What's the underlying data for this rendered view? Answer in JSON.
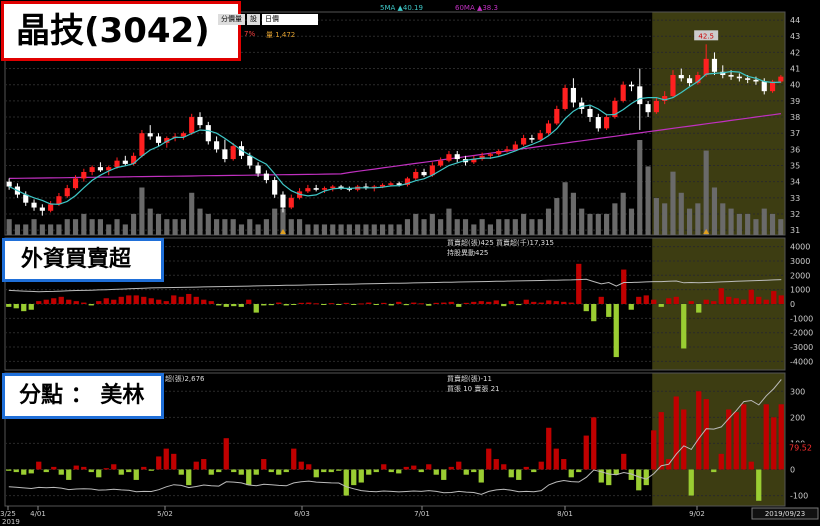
{
  "title": "晶技(3042)",
  "subchart1_label": "外資買賣超",
  "subchart2_label": "分點 ： 美林",
  "toolbar": {
    "btn1": "分價量",
    "btn2": "設",
    "period": "日價"
  },
  "main_info": {
    "change_pct": "7%",
    "volume_label": "量 1,472"
  },
  "legend": {
    "sma": "5MA ▲40.19",
    "ma60": "60MA ▲38.3"
  },
  "price_max_label": "42.5",
  "sub1_info": {
    "line1": "買賣超(張)425 買賣超(千)17,315",
    "line2": "持股異動425"
  },
  "sub2_info": {
    "left": "超(張)2,676",
    "line1": "買賣超(張)-11",
    "line2": "買張 10 賣張 21"
  },
  "sub2_last_value": "79.52",
  "bottom_dates": [
    "3/25",
    "4/01",
    "5/02",
    "6/03",
    "7/01",
    "8/01",
    "9/02",
    "2019/09/23"
  ],
  "year_label": "2019",
  "colors": {
    "up": "#ff2020",
    "down": "#ffffff",
    "ma5": "#3ec7c7",
    "ma60": "#c030c0",
    "sell": "#9acd32",
    "buy": "#c00000",
    "highlight": "#3d3d12"
  },
  "chart_data": [
    {
      "type": "candlestick",
      "y_ticks": [
        31,
        32,
        33,
        34,
        35,
        36,
        37,
        38,
        39,
        40,
        41,
        42,
        43,
        44
      ],
      "ylim": [
        30.7,
        44.5
      ],
      "ohlc": [
        [
          34.0,
          34.2,
          33.5,
          33.7
        ],
        [
          33.7,
          33.9,
          33.0,
          33.2
        ],
        [
          33.2,
          33.4,
          32.5,
          32.7
        ],
        [
          32.7,
          32.9,
          32.2,
          32.4
        ],
        [
          32.4,
          32.6,
          31.9,
          32.2
        ],
        [
          32.2,
          32.8,
          32.1,
          32.6
        ],
        [
          32.6,
          33.3,
          32.5,
          33.1
        ],
        [
          33.1,
          33.8,
          33.0,
          33.6
        ],
        [
          33.6,
          34.4,
          33.5,
          34.2
        ],
        [
          34.2,
          34.8,
          34.0,
          34.6
        ],
        [
          34.6,
          35.0,
          34.4,
          34.9
        ],
        [
          34.9,
          35.2,
          34.6,
          34.7
        ],
        [
          34.7,
          35.0,
          34.4,
          34.9
        ],
        [
          34.9,
          35.5,
          34.8,
          35.3
        ],
        [
          35.3,
          35.6,
          35.0,
          35.1
        ],
        [
          35.1,
          35.8,
          35.0,
          35.6
        ],
        [
          35.6,
          37.2,
          35.5,
          37.0
        ],
        [
          37.0,
          37.5,
          36.6,
          36.8
        ],
        [
          36.8,
          37.0,
          36.2,
          36.4
        ],
        [
          36.4,
          36.8,
          36.1,
          36.7
        ],
        [
          36.7,
          37.0,
          36.5,
          36.8
        ],
        [
          36.8,
          37.1,
          36.6,
          37.0
        ],
        [
          37.0,
          38.2,
          36.9,
          38.0
        ],
        [
          38.0,
          38.3,
          37.3,
          37.5
        ],
        [
          37.5,
          37.7,
          36.3,
          36.5
        ],
        [
          36.5,
          36.8,
          35.8,
          36.0
        ],
        [
          36.0,
          36.6,
          35.2,
          35.4
        ],
        [
          35.4,
          36.4,
          35.3,
          36.2
        ],
        [
          36.2,
          36.5,
          35.4,
          35.6
        ],
        [
          35.6,
          35.8,
          34.8,
          35.0
        ],
        [
          35.0,
          35.2,
          34.3,
          34.5
        ],
        [
          34.5,
          34.7,
          33.9,
          34.1
        ],
        [
          34.1,
          34.3,
          33.0,
          33.2
        ],
        [
          33.2,
          33.4,
          32.1,
          32.4
        ],
        [
          32.4,
          33.2,
          32.3,
          33.0
        ],
        [
          33.0,
          33.6,
          32.9,
          33.4
        ],
        [
          33.4,
          33.8,
          33.3,
          33.6
        ],
        [
          33.6,
          33.8,
          33.4,
          33.5
        ],
        [
          33.5,
          33.7,
          33.3,
          33.6
        ],
        [
          33.6,
          33.8,
          33.4,
          33.7
        ],
        [
          33.7,
          33.8,
          33.5,
          33.6
        ],
        [
          33.6,
          33.7,
          33.4,
          33.5
        ],
        [
          33.5,
          33.8,
          33.4,
          33.7
        ],
        [
          33.7,
          33.9,
          33.5,
          33.6
        ],
        [
          33.6,
          33.8,
          33.4,
          33.7
        ],
        [
          33.7,
          33.9,
          33.6,
          33.8
        ],
        [
          33.8,
          34.0,
          33.7,
          33.9
        ],
        [
          33.9,
          34.0,
          33.7,
          33.8
        ],
        [
          33.8,
          34.3,
          33.7,
          34.2
        ],
        [
          34.2,
          34.8,
          34.1,
          34.6
        ],
        [
          34.6,
          34.8,
          34.3,
          34.4
        ],
        [
          34.4,
          35.2,
          34.3,
          35.0
        ],
        [
          35.0,
          35.5,
          34.9,
          35.3
        ],
        [
          35.3,
          35.9,
          35.2,
          35.7
        ],
        [
          35.7,
          35.9,
          35.2,
          35.4
        ],
        [
          35.4,
          35.6,
          35.0,
          35.2
        ],
        [
          35.2,
          35.6,
          35.1,
          35.4
        ],
        [
          35.4,
          35.8,
          35.3,
          35.6
        ],
        [
          35.6,
          35.8,
          35.4,
          35.7
        ],
        [
          35.7,
          36.0,
          35.6,
          35.9
        ],
        [
          35.9,
          36.2,
          35.8,
          36.0
        ],
        [
          36.0,
          36.5,
          35.9,
          36.3
        ],
        [
          36.3,
          36.9,
          36.2,
          36.7
        ],
        [
          36.7,
          36.9,
          36.4,
          36.6
        ],
        [
          36.6,
          37.2,
          36.5,
          37.0
        ],
        [
          37.0,
          37.8,
          36.9,
          37.6
        ],
        [
          37.6,
          38.7,
          37.5,
          38.5
        ],
        [
          38.5,
          40.0,
          38.4,
          39.8
        ],
        [
          39.8,
          40.4,
          38.6,
          38.9
        ],
        [
          38.9,
          39.2,
          38.2,
          38.5
        ],
        [
          38.5,
          38.7,
          37.7,
          38.0
        ],
        [
          38.0,
          38.2,
          37.1,
          37.3
        ],
        [
          37.3,
          38.2,
          37.2,
          38.0
        ],
        [
          38.0,
          39.2,
          37.9,
          39.0
        ],
        [
          39.0,
          40.2,
          38.9,
          40.0
        ],
        [
          40.0,
          40.2,
          39.6,
          39.9
        ],
        [
          39.9,
          41.0,
          37.2,
          38.8
        ],
        [
          38.8,
          39.0,
          38.0,
          38.3
        ],
        [
          38.3,
          39.2,
          38.2,
          39.0
        ],
        [
          39.0,
          39.6,
          38.8,
          39.3
        ],
        [
          39.3,
          40.9,
          39.2,
          40.6
        ],
        [
          40.6,
          41.0,
          40.2,
          40.4
        ],
        [
          40.4,
          40.6,
          39.9,
          40.1
        ],
        [
          40.1,
          40.8,
          40.0,
          40.6
        ],
        [
          40.6,
          42.5,
          40.5,
          41.6
        ],
        [
          41.6,
          42.0,
          40.6,
          40.8
        ],
        [
          40.8,
          41.2,
          40.4,
          40.6
        ],
        [
          40.6,
          40.9,
          40.3,
          40.5
        ],
        [
          40.5,
          40.7,
          40.2,
          40.4
        ],
        [
          40.4,
          40.6,
          40.1,
          40.3
        ],
        [
          40.3,
          40.5,
          40.0,
          40.2
        ],
        [
          40.2,
          40.4,
          39.4,
          39.6
        ],
        [
          39.6,
          40.3,
          39.5,
          40.2
        ],
        [
          40.2,
          40.6,
          40.1,
          40.5
        ]
      ],
      "volume": [
        3,
        2,
        2,
        3,
        2,
        2,
        2,
        3,
        3,
        4,
        3,
        3,
        2,
        3,
        2,
        4,
        9,
        5,
        4,
        3,
        3,
        3,
        8,
        5,
        4,
        3,
        3,
        3,
        2,
        3,
        2,
        3,
        5,
        5,
        3,
        3,
        2,
        2,
        2,
        2,
        2,
        2,
        2,
        2,
        2,
        2,
        2,
        2,
        3,
        4,
        3,
        4,
        3,
        5,
        3,
        3,
        2,
        3,
        2,
        3,
        3,
        3,
        4,
        3,
        3,
        5,
        7,
        10,
        8,
        5,
        4,
        4,
        4,
        6,
        8,
        5,
        18,
        13,
        7,
        6,
        12,
        8,
        5,
        6,
        16,
        9,
        6,
        5,
        4,
        4,
        3,
        5,
        4,
        3
      ]
    },
    {
      "type": "bar",
      "name": "外資買賣超",
      "y_ticks": [
        4000,
        3000,
        2000,
        1000,
        0,
        -1000,
        -2000,
        -3000,
        -4000
      ],
      "ylim": [
        -4600,
        4600
      ],
      "values": [
        -200,
        -300,
        -500,
        -400,
        200,
        300,
        400,
        500,
        300,
        200,
        100,
        -100,
        200,
        400,
        300,
        500,
        600,
        600,
        500,
        400,
        300,
        200,
        600,
        500,
        700,
        500,
        300,
        200,
        -100,
        -200,
        -150,
        -200,
        300,
        -600,
        -100,
        -80,
        100,
        -100,
        -50,
        80,
        100,
        50,
        -60,
        60,
        -40,
        80,
        -70,
        40,
        100,
        -60,
        80,
        -100,
        150,
        -80,
        100,
        50,
        -120,
        80,
        100,
        150,
        -200,
        80,
        150,
        200,
        150,
        250,
        -150,
        200,
        -80,
        300,
        150,
        100,
        250,
        200,
        150,
        100,
        2800,
        -500,
        -1200,
        500,
        -900,
        -3700,
        2400,
        -400,
        500,
        600,
        300,
        -200,
        400,
        500,
        -3100,
        200,
        -600,
        300,
        200,
        1100,
        500,
        400,
        300,
        1000,
        500,
        300,
        900,
        600
      ],
      "line": [
        950,
        920,
        900,
        880,
        860,
        870,
        880,
        900,
        920,
        940,
        950,
        960,
        980,
        1000,
        1020,
        1040,
        1060,
        1080,
        1100,
        1120,
        1130,
        1140,
        1150,
        1160,
        1170,
        1180,
        1190,
        1200,
        1210,
        1220,
        1230,
        1240,
        1250,
        1260,
        1270,
        1280,
        1290,
        1300,
        1310,
        1320,
        1330,
        1340,
        1350,
        1360,
        1370,
        1380,
        1390,
        1400,
        1410,
        1420,
        1430,
        1440,
        1450,
        1460,
        1470,
        1480,
        1490,
        1500,
        1510,
        1520,
        1530,
        1540,
        1550,
        1560,
        1570,
        1580,
        1590,
        1600,
        1610,
        1620,
        1630,
        1640,
        1650,
        1660,
        1670,
        1680,
        1700,
        1720,
        1560,
        1400,
        1500,
        1250,
        1500,
        1500,
        1520,
        1540,
        1560,
        1560,
        1580,
        1600,
        1480,
        1500,
        1480,
        1500,
        1520,
        1540,
        1560,
        1580,
        1600,
        1620,
        1640,
        1660,
        1680,
        1700
      ]
    },
    {
      "type": "bar",
      "name": "分點 美林",
      "y_ticks": [
        300,
        200,
        100,
        0,
        -100
      ],
      "ylim": [
        -140,
        370
      ],
      "values": [
        -5,
        -10,
        -20,
        -15,
        30,
        -10,
        10,
        -20,
        -40,
        15,
        10,
        -10,
        -30,
        5,
        20,
        -20,
        -10,
        -40,
        10,
        -5,
        50,
        80,
        60,
        -20,
        -60,
        30,
        40,
        -20,
        -10,
        120,
        -10,
        -20,
        -60,
        -20,
        40,
        -10,
        -20,
        -10,
        80,
        30,
        20,
        -30,
        -10,
        -10,
        -5,
        -100,
        -60,
        -50,
        -20,
        -10,
        20,
        -10,
        -15,
        10,
        15,
        -10,
        20,
        -20,
        -40,
        10,
        30,
        -20,
        -10,
        -50,
        80,
        40,
        20,
        -30,
        -40,
        10,
        -10,
        30,
        160,
        80,
        40,
        -30,
        -10,
        130,
        200,
        -50,
        -60,
        -20,
        60,
        -40,
        -80,
        -60,
        150,
        220,
        40,
        280,
        230,
        -100,
        300,
        270,
        -10,
        60,
        230,
        220,
        250,
        30,
        -120,
        250,
        200,
        250
      ]
    }
  ]
}
